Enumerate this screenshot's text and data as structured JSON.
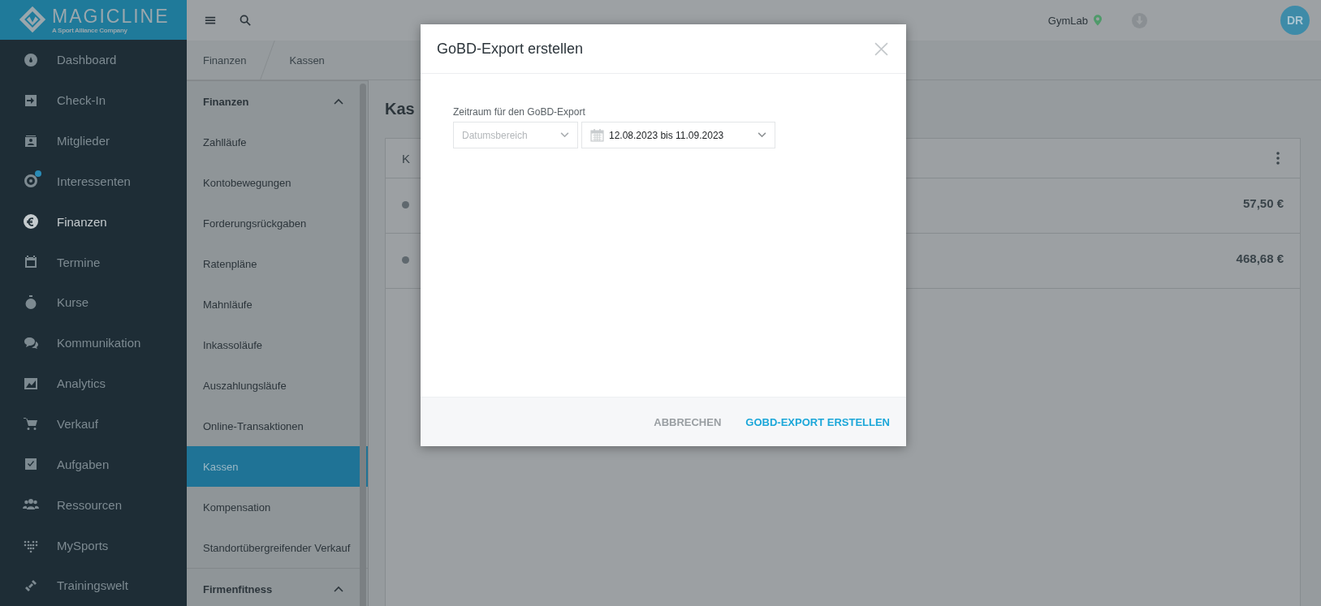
{
  "logo": {
    "name": "MAGICLINE",
    "tagline": "A Sport Alliance Company"
  },
  "nav": [
    {
      "label": "Dashboard",
      "selected": false,
      "notification": false
    },
    {
      "label": "Check-In",
      "selected": false,
      "notification": false
    },
    {
      "label": "Mitglieder",
      "selected": false,
      "notification": false
    },
    {
      "label": "Interessenten",
      "selected": false,
      "notification": true
    },
    {
      "label": "Finanzen",
      "selected": true,
      "notification": false
    },
    {
      "label": "Termine",
      "selected": false,
      "notification": false
    },
    {
      "label": "Kurse",
      "selected": false,
      "notification": false
    },
    {
      "label": "Kommunikation",
      "selected": false,
      "notification": false
    },
    {
      "label": "Analytics",
      "selected": false,
      "notification": false
    },
    {
      "label": "Verkauf",
      "selected": false,
      "notification": false
    },
    {
      "label": "Aufgaben",
      "selected": false,
      "notification": false
    },
    {
      "label": "Ressourcen",
      "selected": false,
      "notification": false
    },
    {
      "label": "MySports",
      "selected": false,
      "notification": false
    },
    {
      "label": "Trainingswelt",
      "selected": false,
      "notification": false
    }
  ],
  "topbar": {
    "location": "GymLab",
    "avatar": "DR"
  },
  "breadcrumbs": [
    "Finanzen",
    "Kassen"
  ],
  "subnav": [
    {
      "title": "Finanzen",
      "expanded": true,
      "items": [
        {
          "label": "Zahlläufe",
          "selected": false
        },
        {
          "label": "Kontobewegungen",
          "selected": false
        },
        {
          "label": "Forderungsrückgaben",
          "selected": false
        },
        {
          "label": "Ratenpläne",
          "selected": false
        },
        {
          "label": "Mahnläufe",
          "selected": false
        },
        {
          "label": "Inkassoläufe",
          "selected": false
        },
        {
          "label": "Auszahlungsläufe",
          "selected": false
        },
        {
          "label": "Online-Transaktionen",
          "selected": false
        },
        {
          "label": "Kassen",
          "selected": true
        },
        {
          "label": "Kompensation",
          "selected": false
        },
        {
          "label": "Standortübergreifender Verkauf",
          "selected": false
        }
      ]
    },
    {
      "title": "Firmenfitness",
      "expanded": true
    }
  ],
  "page": {
    "heading": "Kas",
    "card": {
      "header": "K",
      "rows": [
        {
          "amount": "57,50 €"
        },
        {
          "amount": "468,68 €"
        }
      ]
    }
  },
  "dialog": {
    "title": "GoBD-Export erstellen",
    "field_label": "Zeitraum für den GoBD-Export",
    "range_type": {
      "placeholder": "Datumsbereich"
    },
    "date_range": {
      "value": "12.08.2023 bis 11.09.2023"
    },
    "cancel": "ABBRECHEN",
    "confirm": "GOBD-EXPORT ERSTELLEN"
  }
}
